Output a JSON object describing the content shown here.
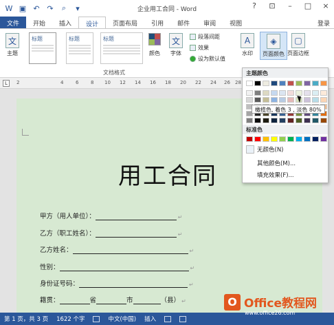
{
  "title_bar": {
    "title": "企业用工合同 - Word",
    "controls": [
      "?",
      "⊡",
      "–",
      "□",
      "×"
    ]
  },
  "tabs": {
    "items": [
      "文件",
      "开始",
      "插入",
      "设计",
      "页面布局",
      "引用",
      "邮件",
      "审阅",
      "视图"
    ],
    "active_index": 3,
    "sign_in": "登录"
  },
  "ribbon": {
    "theme_label": "主题",
    "style_gallery": [
      "标题",
      "标题",
      "标题"
    ],
    "group_label": "文档格式",
    "colors_label": "颜色",
    "fonts_label": "字体",
    "paragraph_spacing": "段落间距",
    "effects": "效果",
    "set_default": "设为默认值",
    "watermark": "水印",
    "page_color": "页面颜色",
    "page_borders": "页面边框",
    "colors": [
      "#1f4e79",
      "#c0504d",
      "#9bbb59",
      "#8064a2"
    ]
  },
  "ruler": {
    "ticks": [
      "2",
      "4",
      "6",
      "8",
      "10",
      "12",
      "14",
      "16",
      "18",
      "20",
      "22",
      "24",
      "26",
      "28"
    ]
  },
  "document": {
    "title": "用工合同",
    "fields": [
      {
        "label": "甲方（用人单位）："
      },
      {
        "label": "乙方（职工姓名）："
      },
      {
        "label": "乙方姓名："
      },
      {
        "label": "性别："
      },
      {
        "label": "身份证号码："
      }
    ],
    "last_row": {
      "label": "籍贯：",
      "province": "省",
      "city": "市",
      "county": "（县）"
    },
    "para_mark": "↵",
    "page_color": "#d7e9d2"
  },
  "color_panel": {
    "theme_header": "主题颜色",
    "standard_header": "标准色",
    "no_color": "无颜色(N)",
    "more_colors": "其他颜色(M)...",
    "fill_effects": "填充效果(F)...",
    "tooltip": "橄榄色, 着色 3 , 淡色 80%",
    "theme_top_row": [
      "#ffffff",
      "#000000",
      "#eeece1",
      "#1f497d",
      "#4f81bd",
      "#c0504d",
      "#9bbb59",
      "#8064a2",
      "#4bacc6",
      "#f79646"
    ],
    "theme_shades": [
      [
        "#f2f2f2",
        "#7f7f7f",
        "#ddd9c3",
        "#c6d9f0",
        "#dbe5f1",
        "#f2dcdb",
        "#ebf1dd",
        "#e5e0ec",
        "#dbeef3",
        "#fdeada"
      ],
      [
        "#d8d8d8",
        "#595959",
        "#c4bd97",
        "#8db3e2",
        "#b8cce4",
        "#e5b9b7",
        "#d7e3bc",
        "#ccc1d9",
        "#b7dde8",
        "#fbd5b5"
      ],
      [
        "#bfbfbf",
        "#3f3f3f",
        "#938953",
        "#548dd4",
        "#95b3d7",
        "#d99694",
        "#c3d69b",
        "#b2a2c7",
        "#92cddc",
        "#fac08f"
      ],
      [
        "#a5a5a5",
        "#262626",
        "#494429",
        "#17365d",
        "#366092",
        "#953734",
        "#76923c",
        "#5f497a",
        "#31859b",
        "#e36c09"
      ],
      [
        "#7f7f7f",
        "#0c0c0c",
        "#1d1b10",
        "#0f243e",
        "#244061",
        "#632423",
        "#4f6128",
        "#3f3151",
        "#205867",
        "#974806"
      ]
    ],
    "standard_colors": [
      "#c00000",
      "#ff0000",
      "#ffc000",
      "#ffff00",
      "#92d050",
      "#00b050",
      "#00b0f0",
      "#0070c0",
      "#002060",
      "#7030a0"
    ]
  },
  "status_bar": {
    "page": "第 1 页，共 3 页",
    "words": "1622 个字",
    "language": "中文(中国)",
    "mode": "插入"
  },
  "watermark": {
    "logo_letter": "O",
    "text": "Office教程网",
    "url": "www.office26.com"
  }
}
